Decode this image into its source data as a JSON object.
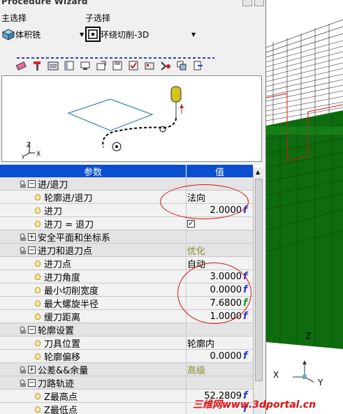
{
  "window": {
    "title": "Procedure Wizard"
  },
  "main_select": {
    "label": "主选择",
    "value": "体积铣"
  },
  "sub_select": {
    "label": "子选择",
    "value": "环绕切削-3D"
  },
  "toolbar": {
    "icons": [
      "eraser-icon",
      "tool-icon",
      "cut-param-icon",
      "table-icon",
      "monitor-icon",
      "export-icon",
      "save-icon",
      "check-icon",
      "compute-icon",
      "simulate-icon",
      "batch-icon",
      "exit-icon"
    ]
  },
  "preview": {
    "axis_z": "Z",
    "axis_x": "X",
    "axis_y": "y"
  },
  "grid": {
    "col_param": "参数",
    "col_value": "值",
    "rows": [
      {
        "type": "group",
        "name": "进/退刀",
        "value": "",
        "lock": true
      },
      {
        "type": "item",
        "name": "轮廓进/退刀",
        "value": "法向"
      },
      {
        "type": "item",
        "name": "进刀",
        "value": "2.0000",
        "fx": "f"
      },
      {
        "type": "item",
        "name": "进刀 = 退刀",
        "value": "",
        "check": "✓"
      },
      {
        "type": "group",
        "name": "安全平面和坐标系",
        "value": "",
        "collapsed": true
      },
      {
        "type": "group",
        "name": "进刀和退刀点",
        "value": "优化",
        "lock": true
      },
      {
        "type": "item",
        "name": "进刀点",
        "value": "自动"
      },
      {
        "type": "item",
        "name": "进刀角度",
        "value": "3.0000",
        "fx": "f"
      },
      {
        "type": "item",
        "name": "最小切削宽度",
        "value": "0.0000",
        "fx": "f"
      },
      {
        "type": "item",
        "name": "最大螺旋半径",
        "value": "7.6800",
        "fx": "f",
        "fxcolor": "green"
      },
      {
        "type": "item",
        "name": "缓刀距离",
        "value": "1.0000",
        "fx": "f"
      },
      {
        "type": "group",
        "name": "轮廓设置",
        "value": "",
        "lock": true
      },
      {
        "type": "item",
        "name": "刀具位置",
        "value": "轮廓内"
      },
      {
        "type": "item",
        "name": "轮廓偏移",
        "value": "0.0000",
        "fx": "f"
      },
      {
        "type": "group",
        "name": "公差&&余量",
        "value": "高级",
        "collapsed": true
      },
      {
        "type": "group",
        "name": "刀路轨迹",
        "value": "",
        "lock": true
      },
      {
        "type": "item",
        "name": "Z最高点",
        "value": "52.2809",
        "fx": "f"
      },
      {
        "type": "item",
        "name": "Z最低点",
        "value": "",
        "fx": "f"
      }
    ]
  },
  "viewport": {
    "axis_z": "Z",
    "axis_x": "X",
    "axis_y": "Y"
  },
  "watermark": {
    "text1": "三维网",
    "text2": "www.3dportal.cn"
  },
  "colors": {
    "header_blue": "#0a4fd0",
    "annotation_red": "#d71414",
    "fx_blue": "#2a3bd4",
    "fx_green": "#1f9a1f",
    "model_green": "#0f6b0f"
  }
}
